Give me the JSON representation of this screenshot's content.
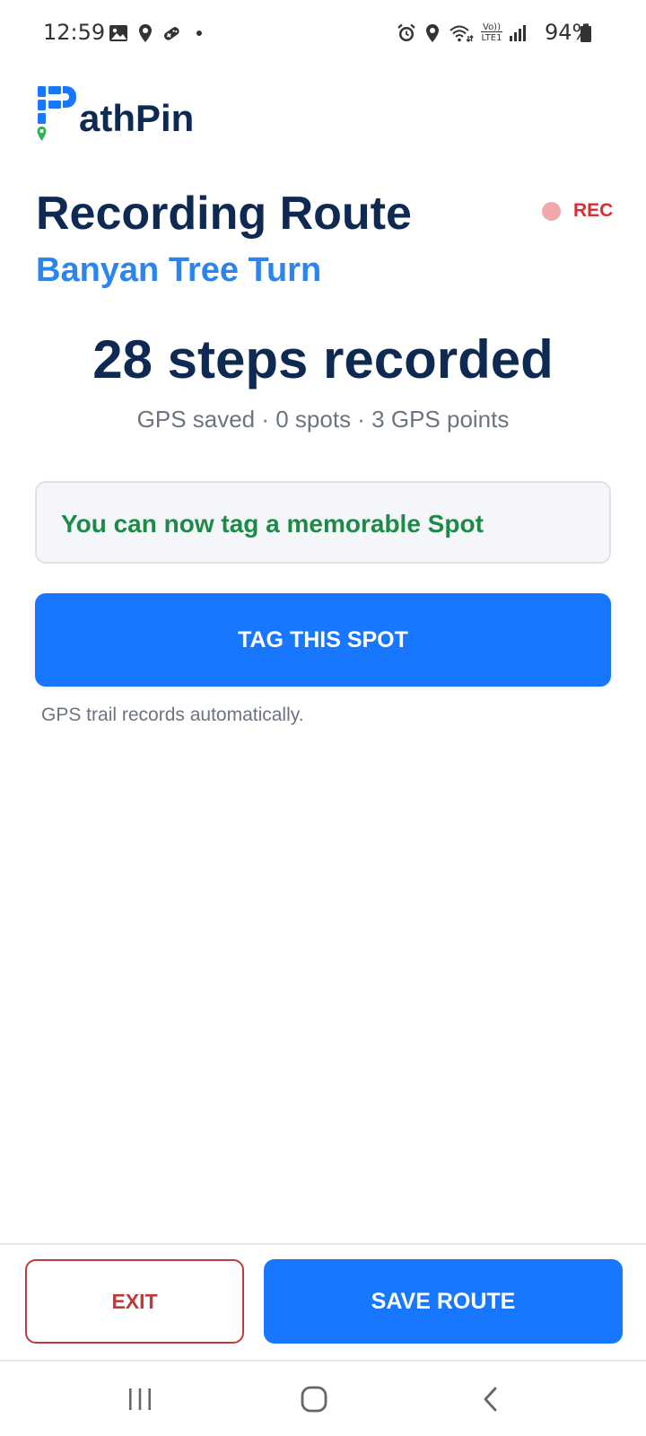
{
  "status_bar": {
    "time": "12:59",
    "battery": "94%",
    "left_icons": [
      "gallery-icon",
      "location-icon",
      "game-controller-icon",
      "dot-icon"
    ],
    "right_icons": [
      "alarm-icon",
      "location-icon",
      "wifi-icon",
      "volte-lte-icon",
      "signal-icon",
      "battery-icon"
    ],
    "volte_label": "Vo)) LTE1"
  },
  "app": {
    "logo_text": "athPin",
    "logo_letter": "P"
  },
  "header": {
    "title": "Recording Route",
    "route_name": "Banyan Tree Turn",
    "rec_label": "REC"
  },
  "stats": {
    "steps_text": "28 steps recorded",
    "summary": "GPS saved · 0 spots · 3 GPS points"
  },
  "info": {
    "message": "You can now tag a memorable Spot"
  },
  "actions": {
    "tag_label": "TAG THIS SPOT",
    "hint": "GPS trail records automatically.",
    "exit_label": "EXIT",
    "save_label": "SAVE ROUTE"
  },
  "colors": {
    "primary": "#1877ff",
    "navy": "#0e2a52",
    "accent_blue": "#2c84f0",
    "success_green": "#1d8a48",
    "danger_red": "#c0393b"
  },
  "nav": {
    "items": [
      "recents-icon",
      "home-icon",
      "back-icon"
    ]
  }
}
